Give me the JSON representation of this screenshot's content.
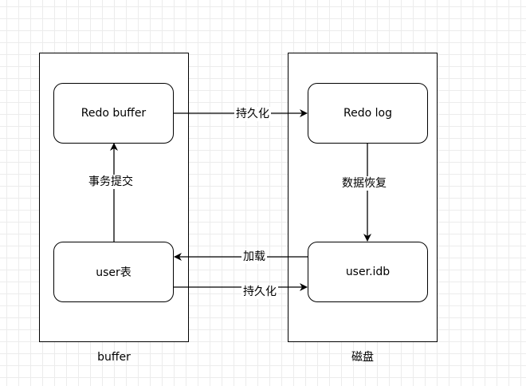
{
  "containers": {
    "buffer": {
      "caption": "buffer"
    },
    "disk": {
      "caption": "磁盘"
    }
  },
  "nodes": {
    "redo_buffer": "Redo buffer",
    "user_table": "user表",
    "redo_log": "Redo log",
    "user_idb": "user.idb"
  },
  "edges": {
    "persist_top": "持久化",
    "commit": "事务提交",
    "recover": "数据恢复",
    "load": "加载",
    "persist_bottom": "持久化"
  }
}
